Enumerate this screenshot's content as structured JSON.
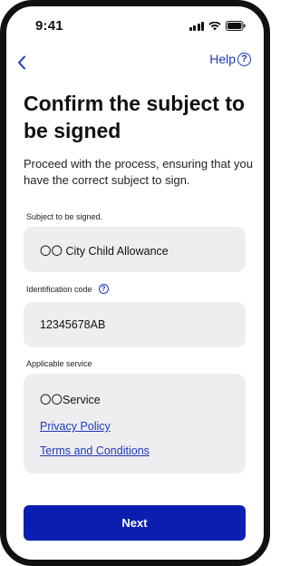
{
  "status_bar": {
    "time": "9:41"
  },
  "nav": {
    "help_label": "Help",
    "help_icon_glyph": "?"
  },
  "title": "Confirm the subject to be signed",
  "description": "Proceed with the process, ensuring that you have the correct subject to sign.",
  "fields": {
    "subject": {
      "label": "Subject to be signed.",
      "value": "〇〇 City Child Allowance"
    },
    "identification_code": {
      "label": "Identification code",
      "info_icon_glyph": "?",
      "value": "12345678AB"
    },
    "applicable_service": {
      "label": "Applicable service",
      "value": "〇〇Service",
      "links": {
        "privacy": "Privacy Policy",
        "terms": "Terms and Conditions"
      }
    }
  },
  "primary_button_label": "Next",
  "colors": {
    "accent": "#1f38b8",
    "primary_button": "#0a1fb0",
    "field_background": "#eeeef1"
  }
}
